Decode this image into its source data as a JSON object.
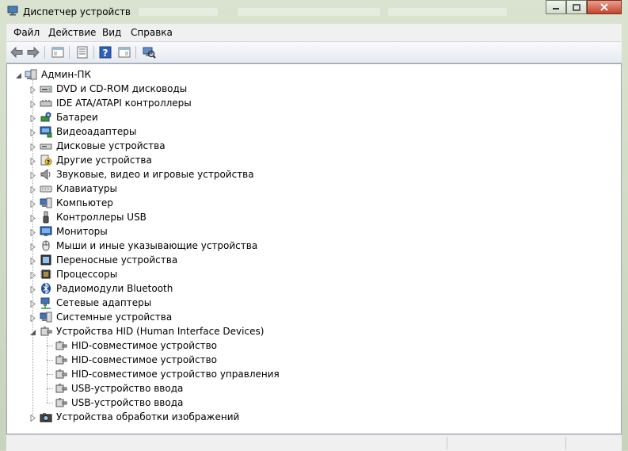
{
  "window": {
    "title": "Диспетчер устройств",
    "minimize_icon": "minimize-icon",
    "maximize_icon": "maximize-icon",
    "close_icon": "close-icon"
  },
  "menu": {
    "file": "Файл",
    "action": "Действие",
    "view": "Вид",
    "help": "Справка"
  },
  "toolbar": {
    "buttons": [
      "back-arrow-icon",
      "forward-arrow-icon",
      "show-hide-console-tree-icon",
      "properties-icon",
      "help-icon",
      "action-pane-icon",
      "scan-hardware-icon"
    ]
  },
  "tree": {
    "root": "Админ-ПК",
    "categories": [
      {
        "label": "DVD и CD-ROM дисководы",
        "icon": "dvd-drive-icon",
        "expanded": false
      },
      {
        "label": "IDE ATA/ATAPI контроллеры",
        "icon": "ide-controller-icon",
        "expanded": false
      },
      {
        "label": "Батареи",
        "icon": "battery-icon",
        "expanded": false
      },
      {
        "label": "Видеоадаптеры",
        "icon": "display-adapter-icon",
        "expanded": false
      },
      {
        "label": "Дисковые устройства",
        "icon": "disk-drive-icon",
        "expanded": false
      },
      {
        "label": "Другие устройства",
        "icon": "unknown-device-icon",
        "expanded": false
      },
      {
        "label": "Звуковые, видео и игровые устройства",
        "icon": "speaker-icon",
        "expanded": false
      },
      {
        "label": "Клавиатуры",
        "icon": "keyboard-icon",
        "expanded": false
      },
      {
        "label": "Компьютер",
        "icon": "computer-icon",
        "expanded": false
      },
      {
        "label": "Контроллеры USB",
        "icon": "usb-icon",
        "expanded": false
      },
      {
        "label": "Мониторы",
        "icon": "monitor-icon",
        "expanded": false
      },
      {
        "label": "Мыши и иные указывающие устройства",
        "icon": "mouse-icon",
        "expanded": false
      },
      {
        "label": "Переносные устройства",
        "icon": "portable-device-icon",
        "expanded": false
      },
      {
        "label": "Процессоры",
        "icon": "processor-icon",
        "expanded": false
      },
      {
        "label": "Радиомодули Bluetooth",
        "icon": "bluetooth-icon",
        "expanded": false
      },
      {
        "label": "Сетевые адаптеры",
        "icon": "network-adapter-icon",
        "expanded": false
      },
      {
        "label": "Системные устройства",
        "icon": "system-device-icon",
        "expanded": false
      },
      {
        "label": "Устройства HID (Human Interface Devices)",
        "icon": "hid-icon",
        "expanded": true
      },
      {
        "label": "Устройства обработки изображений",
        "icon": "imaging-device-icon",
        "expanded": false
      }
    ],
    "hid_children": [
      "HID-совместимое устройство",
      "HID-совместимое устройство",
      "HID-совместимое устройство управления",
      "USB-устройство ввода",
      "USB-устройство ввода"
    ]
  },
  "colors": {
    "accent": "#3c7fb1",
    "window_frame": "#cfd9c4"
  }
}
